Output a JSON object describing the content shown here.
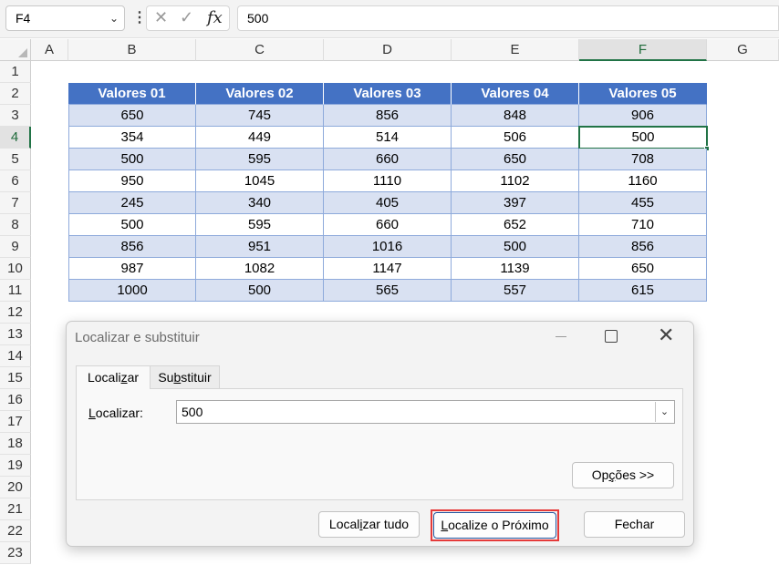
{
  "formula_bar": {
    "name_box": "F4",
    "chevron": "⌄",
    "dots": "⋮",
    "cancel_glyph": "✕",
    "enter_glyph": "✓",
    "fx_glyph": "fx",
    "value": "500"
  },
  "sheet": {
    "columns": [
      "A",
      "B",
      "C",
      "D",
      "E",
      "F",
      "G"
    ],
    "selected_column": "F",
    "rows": [
      "1",
      "2",
      "3",
      "4",
      "5",
      "6",
      "7",
      "8",
      "9",
      "10",
      "11",
      "12",
      "13",
      "14",
      "15",
      "16",
      "17",
      "18",
      "19",
      "20",
      "21",
      "22",
      "23"
    ],
    "selected_row": "4",
    "active_cell": "F4"
  },
  "table": {
    "headers": [
      "Valores 01",
      "Valores 02",
      "Valores 03",
      "Valores 04",
      "Valores 05"
    ],
    "rows": [
      [
        "650",
        "745",
        "856",
        "848",
        "906"
      ],
      [
        "354",
        "449",
        "514",
        "506",
        "500"
      ],
      [
        "500",
        "595",
        "660",
        "650",
        "708"
      ],
      [
        "950",
        "1045",
        "1110",
        "1102",
        "1160"
      ],
      [
        "245",
        "340",
        "405",
        "397",
        "455"
      ],
      [
        "500",
        "595",
        "660",
        "652",
        "710"
      ],
      [
        "856",
        "951",
        "1016",
        "500",
        "856"
      ],
      [
        "987",
        "1082",
        "1147",
        "1139",
        "650"
      ],
      [
        "1000",
        "500",
        "565",
        "557",
        "615"
      ]
    ],
    "header_color": "#4472c4",
    "band_color": "#d9e1f2"
  },
  "dialog": {
    "title": "Localizar e substituir",
    "tabs": {
      "find": {
        "pre": "Locali",
        "key": "z",
        "post": "ar"
      },
      "replace": {
        "pre": "Su",
        "key": "b",
        "post": "stituir"
      }
    },
    "find_label": {
      "pre": "",
      "key": "L",
      "post": "ocalizar:"
    },
    "find_value": "500",
    "options_button": {
      "pre": "Op",
      "key": "ç",
      "post": "ões >>"
    },
    "find_all_button": {
      "pre": "Local",
      "key": "i",
      "post": "zar tudo"
    },
    "find_next_button": {
      "pre": "",
      "key": "L",
      "post": "ocalize o Próximo"
    },
    "close_button": "Fechar",
    "highlight_color": "#e53a3a"
  }
}
